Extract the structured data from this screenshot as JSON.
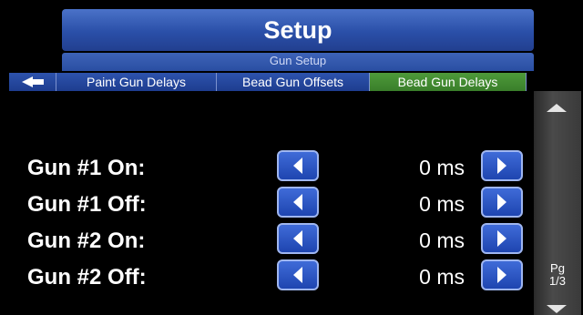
{
  "header": {
    "title": "Setup",
    "subtitle": "Gun Setup"
  },
  "tabs": {
    "back_icon": "left-triangle",
    "items": [
      {
        "label": "Paint Gun Delays"
      },
      {
        "label": "Bead Gun Offsets"
      },
      {
        "label": "Bead Gun Delays",
        "active": true
      }
    ]
  },
  "rows": [
    {
      "label": "Gun #1 On:",
      "value": "0 ms"
    },
    {
      "label": "Gun #1 Off:",
      "value": "0 ms"
    },
    {
      "label": "Gun #2 On:",
      "value": "0 ms"
    },
    {
      "label": "Gun #2 Off:",
      "value": "0 ms"
    }
  ],
  "pager": {
    "line1": "Pg",
    "line2": "1/3"
  },
  "colors": {
    "panel_blue": "#2a4fa8",
    "active_tab_green": "#3a7e2a",
    "button_blue": "#2f58c4"
  }
}
